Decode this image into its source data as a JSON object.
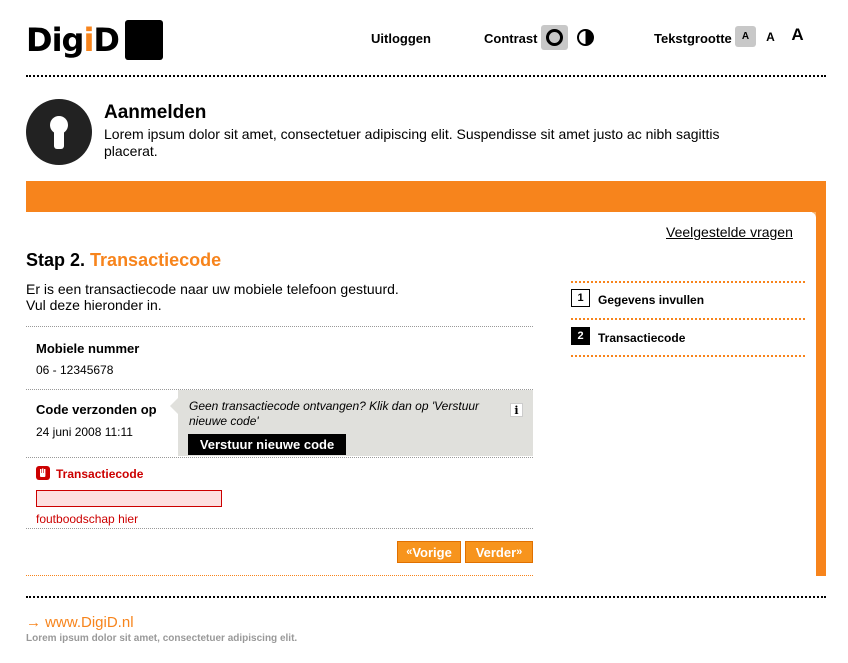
{
  "header": {
    "logo_text_a": "Dig",
    "logo_text_i": "i",
    "logo_text_d": "D",
    "logout_label": "Uitloggen",
    "contrast_label": "Contrast",
    "textsize_label": "Tekstgrootte",
    "textsize_small": "A",
    "textsize_medium": "A",
    "textsize_large": "A"
  },
  "intro": {
    "title": "Aanmelden",
    "text": "Lorem ipsum dolor sit amet, consectetuer adipiscing elit. Suspendisse sit amet justo ac nibh sagittis placerat."
  },
  "faq_link": "Veelgestelde vragen",
  "step": {
    "prefix": "Stap 2.",
    "name": "Transactiecode",
    "description_line1": "Er is een transactiecode naar uw mobiele telefoon gestuurd.",
    "description_line2": "Vul deze hieronder in."
  },
  "fields": {
    "mobile_label": "Mobiele nummer",
    "mobile_value": "06 - 12345678",
    "sent_label": "Code verzonden op",
    "sent_value": "24 juni 2008 11:11",
    "help_text": "Geen transactiecode ontvangen? Klik dan op 'Verstuur nieuwe code'",
    "info_icon_glyph": "i",
    "resend_button": "Verstuur nieuwe code",
    "code_label": "Transactiecode",
    "code_value": "",
    "error_message": "foutboodschap hier"
  },
  "buttons": {
    "prev_arrow": "«",
    "prev_label": "Vorige",
    "next_label": "Verder",
    "next_arrow": "»"
  },
  "steps": [
    {
      "number": "1",
      "label": "Gegevens invullen",
      "active": false
    },
    {
      "number": "2",
      "label": "Transactiecode",
      "active": true
    }
  ],
  "footer": {
    "arrow": "→",
    "link": "www.DigiD.nl",
    "text": "Lorem ipsum dolor sit amet, consectetuer adipiscing elit."
  },
  "colors": {
    "accent": "#f7841c",
    "error": "#cc0000",
    "help_bg": "#e0e0dc"
  },
  "icons": {
    "contrast_normal": "circle-ring-icon",
    "contrast_high": "half-circle-icon",
    "keyhole": "keyhole-icon",
    "error": "hand-stop-icon",
    "info": "info-icon"
  }
}
